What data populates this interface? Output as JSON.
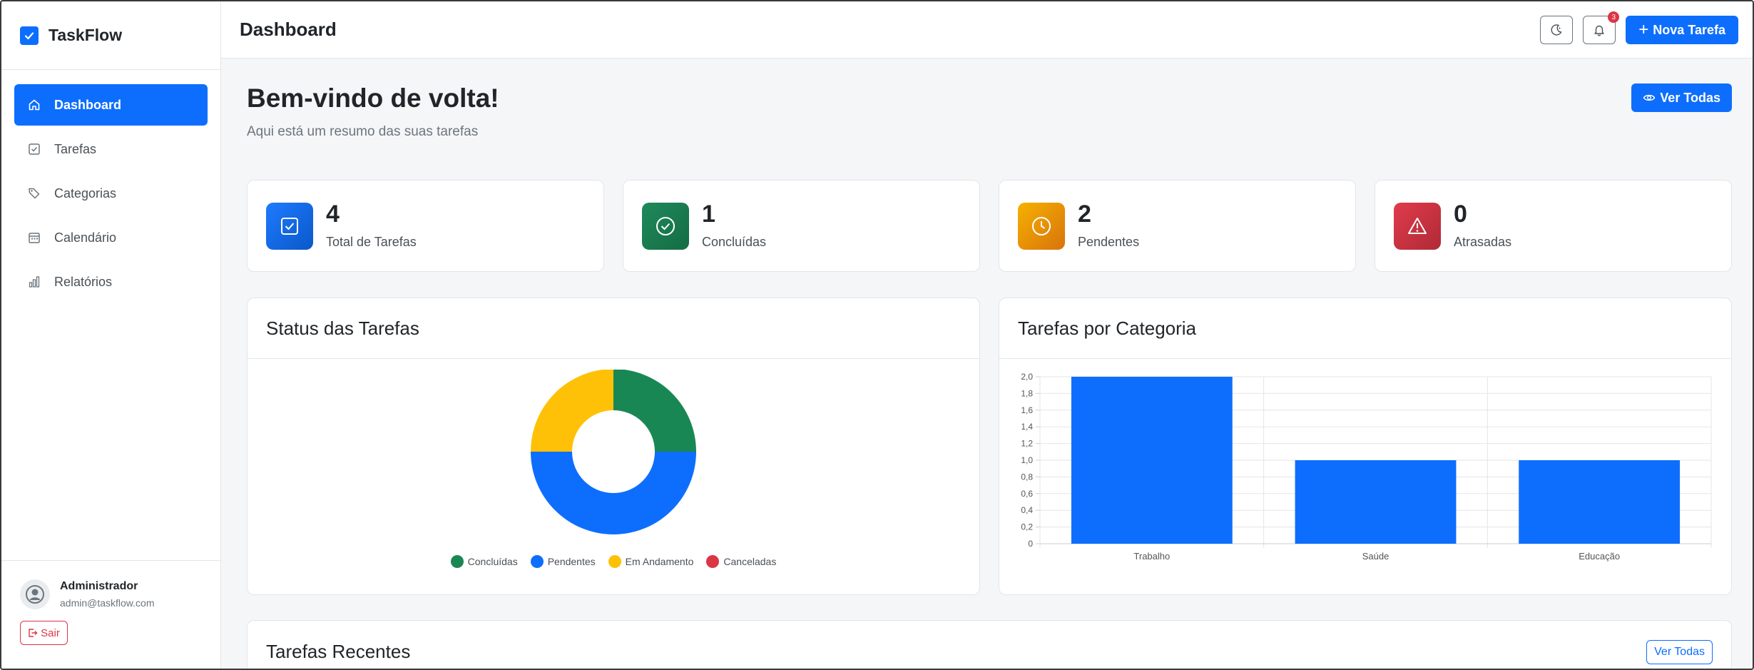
{
  "app": {
    "name": "TaskFlow"
  },
  "sidebar": {
    "items": [
      {
        "label": "Dashboard",
        "icon": "home-icon",
        "active": true
      },
      {
        "label": "Tarefas",
        "icon": "checkbox-icon",
        "active": false
      },
      {
        "label": "Categorias",
        "icon": "tags-icon",
        "active": false
      },
      {
        "label": "Calendário",
        "icon": "calendar-icon",
        "active": false
      },
      {
        "label": "Relatórios",
        "icon": "bar-chart-icon",
        "active": false
      }
    ],
    "user": {
      "name": "Administrador",
      "email": "admin@taskflow.com",
      "logout_label": "Sair"
    }
  },
  "topbar": {
    "title": "Dashboard",
    "notification_count": "3",
    "new_task_label": "Nova Tarefa"
  },
  "main": {
    "welcome_title": "Bem-vindo de volta!",
    "welcome_subtitle": "Aqui está um resumo das suas tarefas",
    "view_all_label": "Ver Todas",
    "stats": [
      {
        "value": "4",
        "label": "Total de Tarefas",
        "color": "#0d6efd",
        "icon": "checkbox-icon"
      },
      {
        "value": "1",
        "label": "Concluídas",
        "color": "#198754",
        "icon": "check-circle-icon"
      },
      {
        "value": "2",
        "label": "Pendentes",
        "color": "#f0a30a",
        "icon": "clock-icon"
      },
      {
        "value": "0",
        "label": "Atrasadas",
        "color": "#dc3545",
        "icon": "warning-icon"
      }
    ],
    "status_panel_title": "Status das Tarefas",
    "category_panel_title": "Tarefas por Categoria",
    "recent_title": "Tarefas Recentes",
    "recent_view_all_label": "Ver Todas"
  },
  "chart_data": [
    {
      "type": "pie",
      "title": "Status das Tarefas",
      "donut": true,
      "slices": [
        {
          "name": "Concluídas",
          "value": 1,
          "color": "#198754"
        },
        {
          "name": "Pendentes",
          "value": 2,
          "color": "#0d6efd"
        },
        {
          "name": "Em Andamento",
          "value": 1,
          "color": "#ffc107"
        },
        {
          "name": "Canceladas",
          "value": 0,
          "color": "#dc3545"
        }
      ],
      "legend": "bottom"
    },
    {
      "type": "bar",
      "title": "Tarefas por Categoria",
      "categories": [
        "Trabalho",
        "Saúde",
        "Educação"
      ],
      "values": [
        2,
        1,
        1
      ],
      "color": "#0d6efd",
      "ylim": [
        0,
        2.0
      ],
      "yticks": [
        "0",
        "0,2",
        "0,4",
        "0,6",
        "0,8",
        "1,0",
        "1,2",
        "1,4",
        "1,6",
        "1,8",
        "2,0"
      ],
      "grid": true
    }
  ]
}
